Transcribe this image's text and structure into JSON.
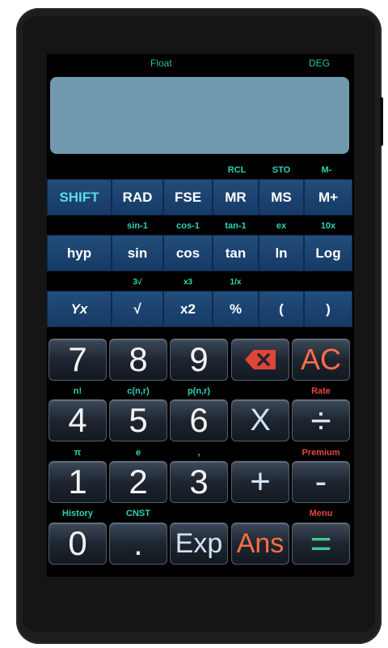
{
  "status": {
    "mode": "Float",
    "angle": "DEG"
  },
  "display": {
    "value": ""
  },
  "row1": {
    "secondary": [
      "RCL",
      "STO",
      "M-"
    ],
    "buttons": [
      "SHIFT",
      "RAD",
      "FSE",
      "MR",
      "MS",
      "M+"
    ]
  },
  "row2": {
    "secondary": [
      "sin-1",
      "cos-1",
      "tan-1",
      "ex",
      "10x"
    ],
    "buttons": [
      "hyp",
      "sin",
      "cos",
      "tan",
      "ln",
      "Log"
    ]
  },
  "row3": {
    "secondary": [
      "3√",
      "x3",
      "1/x"
    ],
    "buttons": [
      "Yx",
      "√",
      "x2",
      "%",
      "(",
      ")"
    ]
  },
  "keypad": {
    "row1": [
      "7",
      "8",
      "9",
      "",
      "AC"
    ],
    "row2_labels": [
      "n!",
      "c(n,r)",
      "p(n,r)",
      "Rate"
    ],
    "row2": [
      "4",
      "5",
      "6",
      "X",
      "÷"
    ],
    "row3_labels": [
      "π",
      "e",
      ",",
      "Premium"
    ],
    "row3": [
      "1",
      "2",
      "3",
      "+",
      "-"
    ],
    "row4_labels": [
      "History",
      "CNST",
      "Menu"
    ],
    "row4": [
      "0",
      ".",
      "Exp",
      "Ans",
      "="
    ]
  },
  "colors": {
    "teal": "#2fd3b6",
    "red": "#e2483a",
    "orange": "#ff6d48",
    "green": "#41c989",
    "display": "#7099ae"
  },
  "icons": {
    "delete": "backspace-icon"
  }
}
